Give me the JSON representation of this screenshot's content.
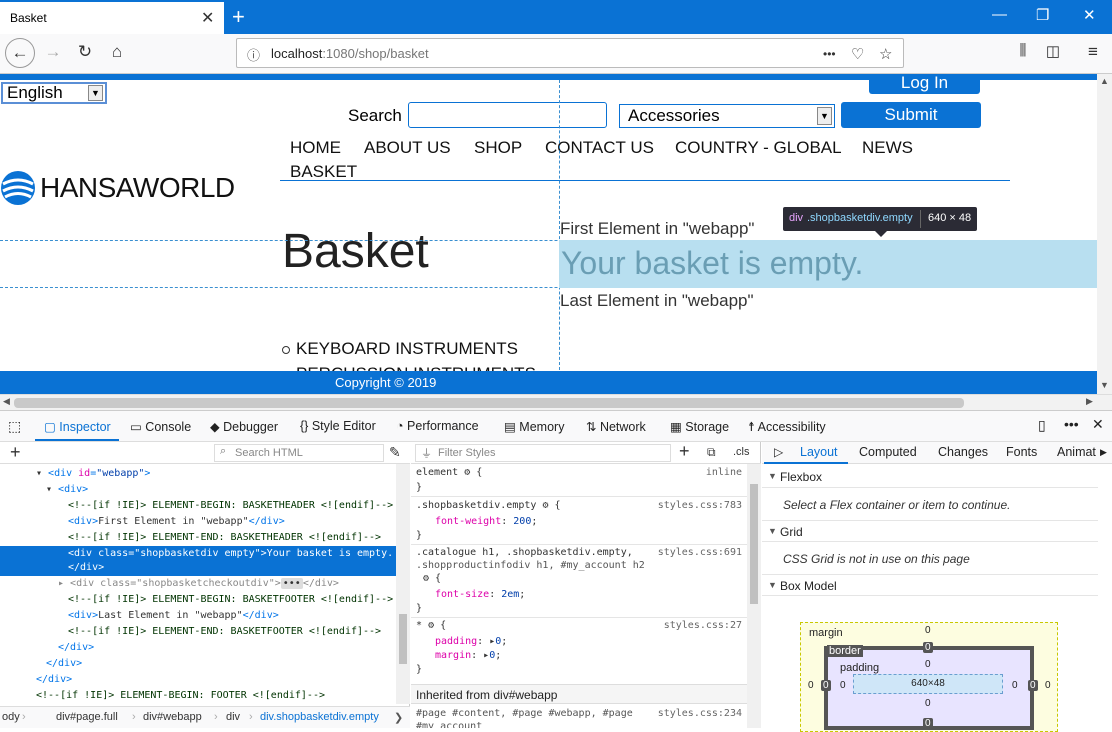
{
  "browser": {
    "tab_title": "Basket",
    "tab_close": "✕",
    "new_tab": "+",
    "url_host": "localhost",
    "url_rest": ":1080/shop/basket",
    "url_more": "•••",
    "win_min": "—",
    "win_max": "❐",
    "win_close": "✕"
  },
  "page": {
    "language": "English",
    "login": "Log In",
    "search_label": "Search",
    "search_value": "",
    "category": "Accessories",
    "submit": "Submit",
    "menu": [
      "HOME",
      "ABOUT US",
      "SHOP",
      "CONTACT US",
      "COUNTRY - GLOBAL",
      "NEWS",
      "BASKET"
    ],
    "logo_text": "HANSAWORLD",
    "heading": "Basket",
    "first_element": "First Element in \"webapp\"",
    "empty_message": "Your basket is empty.",
    "last_element": "Last Element in \"webapp\"",
    "category_item": "KEYBOARD INSTRUMENTS",
    "category_item_2": "PERCUSSION INSTRUMENTS",
    "copyright": "Copyright © 2019",
    "tooltip_tag": "div",
    "tooltip_class": ".shopbasketdiv.empty",
    "tooltip_size": "640 × 48"
  },
  "devtools": {
    "tabs": [
      "Inspector",
      "Console",
      "Debugger",
      "Style Editor",
      "Performance",
      "Memory",
      "Network",
      "Storage",
      "Accessibility"
    ],
    "active_tab": "Inspector",
    "search_html_placeholder": "Search HTML",
    "filter_styles_placeholder": "Filter Styles",
    "cls_label": ".cls",
    "html_lines": [
      {
        "open": "<div ",
        "attr": "id",
        "val": "\"webapp\"",
        "close": ">"
      },
      {
        "open": "<div>",
        "attr": "",
        "val": "",
        "close": ""
      },
      {
        "comment": "<!--[if !IE]> ELEMENT-BEGIN: BASKETHEADER <![endif]-->"
      },
      {
        "open": "<div>",
        "text": "First Element in \"webapp\"",
        "close": "</div>"
      },
      {
        "comment": "<!--[if !IE]> ELEMENT-END: BASKETHEADER <![endif]-->"
      },
      {
        "sel1": "<div class=\"shopbasketdiv empty\">Your basket is empty.",
        "sel2": "</div>"
      },
      {
        "collapsed": "<div class=\"shopbasketcheckoutdiv\">",
        "close": "</div>"
      },
      {
        "comment": "<!--[if !IE]> ELEMENT-BEGIN: BASKETFOOTER <![endif]-->"
      },
      {
        "open": "<div>",
        "text": "Last Element in \"webapp\"",
        "close": "</div>"
      },
      {
        "comment": "<!--[if !IE]> ELEMENT-END: BASKETFOOTER <![endif]-->"
      },
      {
        "close": "</div>"
      },
      {
        "close": "</div>"
      },
      {
        "close": "</div>"
      },
      {
        "comment": "<!--[if !IE]> ELEMENT-BEGIN: FOOTER <![endif]-->"
      }
    ],
    "breadcrumbs": [
      "ody",
      "div#page.full",
      "div#webapp",
      "div",
      "div.shopbasketdiv.empty"
    ],
    "rules": {
      "element_sel": "element",
      "element_src": "inline",
      "r1_sel": ".shopbasketdiv.empty",
      "r1_src": "styles.css:783",
      "r1_prop": "font-weight",
      "r1_val": "200",
      "r2_sel": ".catalogue h1, .shopbasketdiv.empty,",
      "r2_sel2": ".shopproductinfodiv h1, #my_account h2",
      "r2_src": "styles.css:691",
      "r2_prop": "font-size",
      "r2_val": "2em",
      "r3_sel": "*",
      "r3_src": "styles.css:27",
      "r3_prop1": "padding",
      "r3_val1": "0",
      "r3_prop2": "margin",
      "r3_val2": "0",
      "inherited": "Inherited from div#webapp",
      "r4_sel": "#page #content, #page #webapp, #page",
      "r4_sel2": "#my_account",
      "r4_src": "styles.css:234"
    },
    "layout_tabs": [
      "Layout",
      "Computed",
      "Changes",
      "Fonts",
      "Animat"
    ],
    "flexbox_title": "Flexbox",
    "flexbox_note": "Select a Flex container or item to continue.",
    "grid_title": "Grid",
    "grid_note": "CSS Grid is not in use on this page",
    "boxmodel_title": "Box Model",
    "box": {
      "margin_label": "margin",
      "border_label": "border",
      "padding_label": "padding",
      "content_size": "640×48",
      "zero": "0"
    }
  }
}
